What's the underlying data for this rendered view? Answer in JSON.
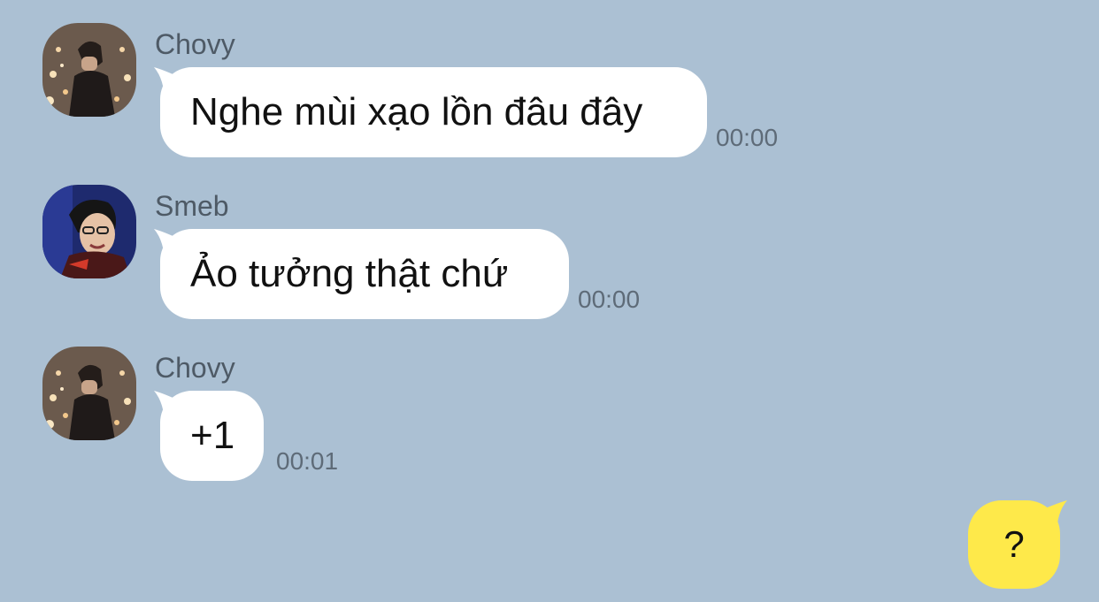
{
  "chat": {
    "messages": [
      {
        "sender": "Chovy",
        "text": "Nghe mùi xạo lồn đâu đây",
        "time": "00:00"
      },
      {
        "sender": "Smeb",
        "text": "Ảo tưởng thật chứ",
        "time": "00:00"
      },
      {
        "sender": "Chovy",
        "text": "+1",
        "time": "00:01"
      }
    ],
    "outgoing": {
      "text": "?"
    }
  },
  "colors": {
    "background": "#abc0d3",
    "incoming_bubble": "#ffffff",
    "outgoing_bubble": "#fee94a",
    "sender_name": "#4e5a66",
    "timestamp": "#5e6b78"
  }
}
